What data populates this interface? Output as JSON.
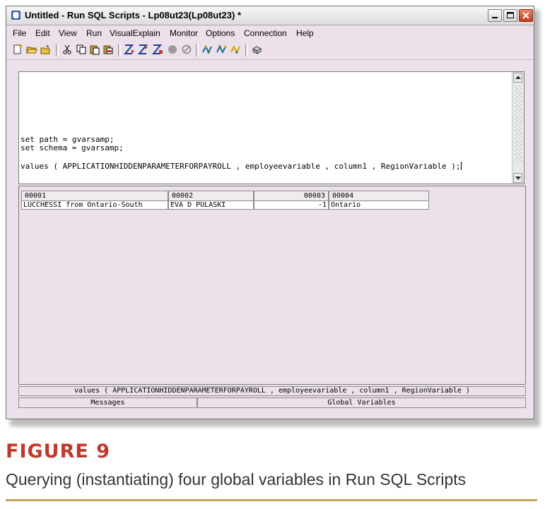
{
  "window": {
    "title": "Untitled - Run SQL Scripts - Lp08ut23(Lp08ut23) *"
  },
  "menu": {
    "items": [
      {
        "label": "File"
      },
      {
        "label": "Edit"
      },
      {
        "label": "View"
      },
      {
        "label": "Run"
      },
      {
        "label": "VisualExplain"
      },
      {
        "label": "Monitor"
      },
      {
        "label": "Options"
      },
      {
        "label": "Connection"
      },
      {
        "label": "Help"
      }
    ]
  },
  "toolbar": {
    "icons": [
      "new-icon",
      "open-icon",
      "save-icon",
      "cut-icon",
      "copy-icon",
      "paste-icon",
      "insert-icon",
      "run-all-icon",
      "run-from-icon",
      "run-selected-icon",
      "stop-icon",
      "cancel-icon",
      "visual-explain-icon",
      "run-explain-icon",
      "explain-icon",
      "print-icon"
    ]
  },
  "editor": {
    "lines": [
      "set path = gvarsamp;",
      "set schema = gvarsamp;",
      "",
      "values ( APPLICATIONHIDDENPARAMETERFORPAYROLL , employeevariable , column1 , RegionVariable );"
    ]
  },
  "results": {
    "columns": [
      "00001",
      "00002",
      "00003",
      "00004"
    ],
    "rows": [
      [
        "LUCCHESSI from Ontario-South",
        "EVA D PULASKI",
        "-1",
        "Ontario"
      ]
    ],
    "statement": "values ( APPLICATIONHIDDENPARAMETERFORPAYROLL , employeevariable , column1 , RegionVariable )"
  },
  "tabs": {
    "messages": "Messages",
    "global_variables": "Global Variables"
  },
  "figure": {
    "title": "FIGURE 9",
    "caption": "Querying (instantiating) four global variables in Run SQL Scripts"
  },
  "colors": {
    "window_bg": "#ece1ea",
    "figure_title": "#c0392b",
    "rule": "#c9a25a"
  }
}
